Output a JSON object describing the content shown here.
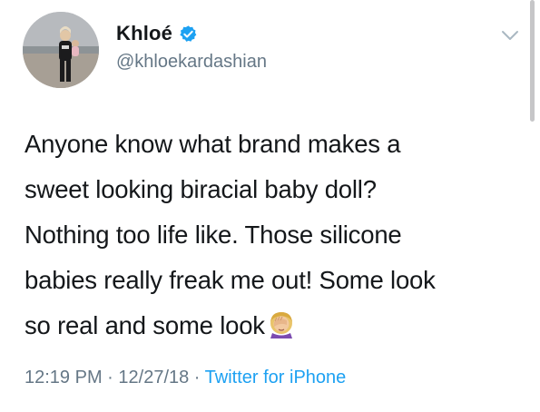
{
  "user": {
    "display_name": "Khloé",
    "handle": "@khloekardashian",
    "verified": true,
    "avatar_icon": "profile-photo"
  },
  "tweet": {
    "lines": [
      "Anyone know what brand makes a",
      "sweet looking biracial baby doll?",
      "Nothing too life like. Those silicone",
      "babies really freak me out! Some look",
      "so real and some look"
    ],
    "emoji": "face-palm-emoji"
  },
  "meta": {
    "time": "12:19 PM",
    "separator": " · ",
    "date": "12/27/18",
    "separator2": " · ",
    "source": "Twitter for iPhone"
  },
  "colors": {
    "text": "#14171a",
    "secondary": "#657786",
    "accent": "#1da1f2"
  }
}
